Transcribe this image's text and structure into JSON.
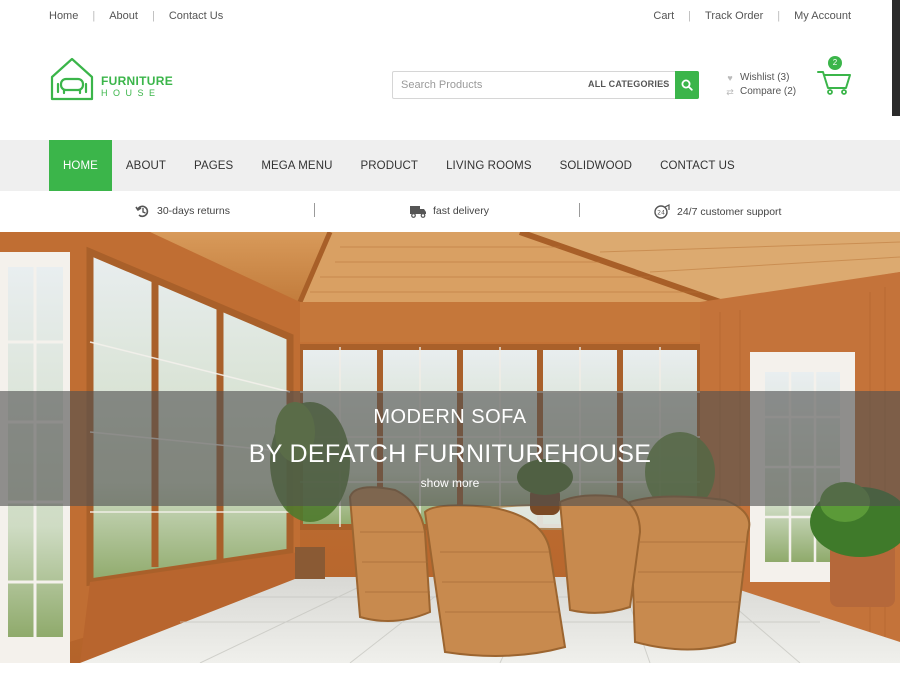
{
  "topbar": {
    "left_links": [
      "Home",
      "About",
      "Contact Us"
    ],
    "right_links": [
      "Cart",
      "Track Order",
      "My Account"
    ]
  },
  "logo": {
    "line1": "FURNITURE",
    "line2": "HOUSE"
  },
  "search": {
    "placeholder": "Search Products",
    "category": "ALL CATEGORIES"
  },
  "wishlist": {
    "label": "Wishlist (3)"
  },
  "compare": {
    "label": "Compare (2)"
  },
  "cart": {
    "count": "2"
  },
  "nav": {
    "items": [
      "HOME",
      "ABOUT",
      "PAGES",
      "MEGA MENU",
      "PRODUCT",
      "LIVING ROOMS",
      "SOLIDWOOD",
      "CONTACT US"
    ],
    "active": "HOME"
  },
  "features": [
    "30-days returns",
    "fast delivery",
    "24/7 customer support"
  ],
  "hero": {
    "line1": "MODERN SOFA",
    "line2": "BY DEFATCH FURNITUREHOUSE",
    "link": "show more"
  },
  "colors": {
    "accent": "#3bb54a",
    "nav_bg": "#efefef",
    "wood": "#c87a3a"
  },
  "icons": [
    "search-icon",
    "heart-icon",
    "compare-icon",
    "cart-icon",
    "chevron-down-icon",
    "returns-icon",
    "truck-icon",
    "support-icon",
    "house-logo-icon"
  ]
}
